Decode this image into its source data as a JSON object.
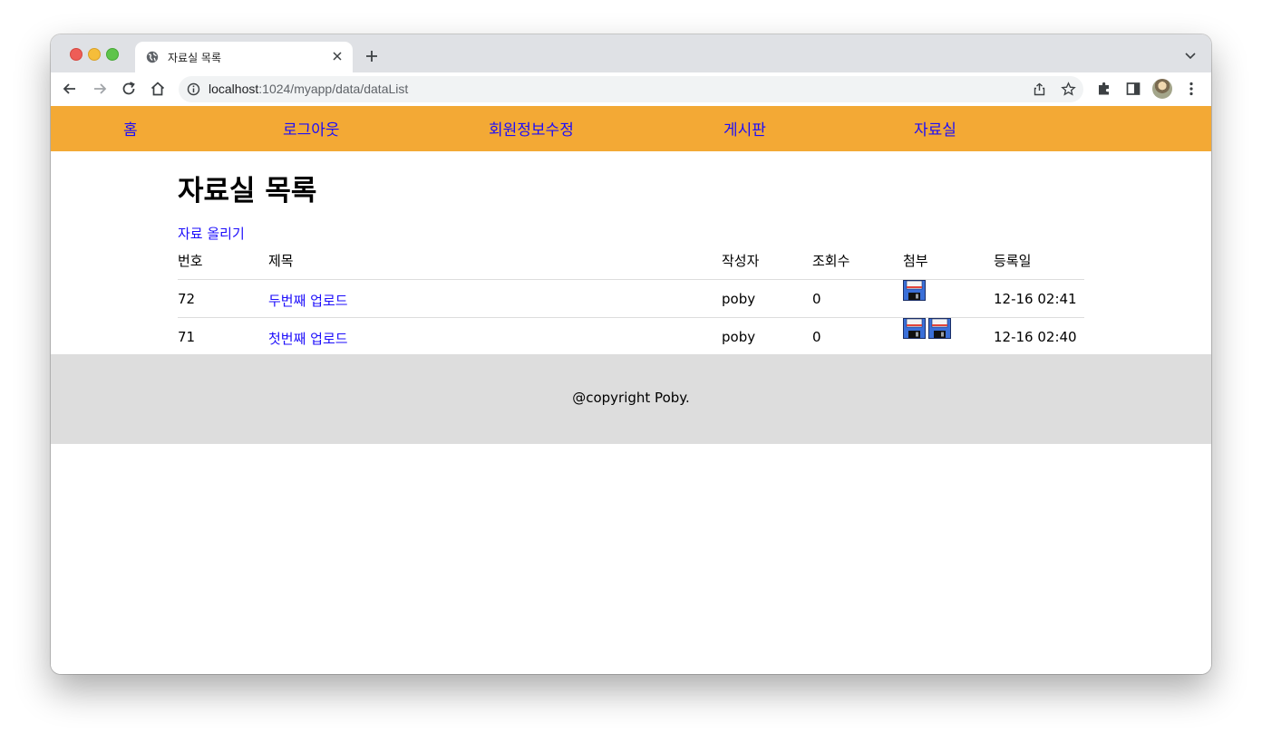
{
  "browser": {
    "tab_title": "자료실 목록",
    "url_host": "localhost",
    "url_rest": ":1024/myapp/data/dataList"
  },
  "nav": {
    "items": [
      "홈",
      "로그아웃",
      "회원정보수정",
      "게시판",
      "자료실"
    ]
  },
  "page": {
    "title": "자료실 목록",
    "upload_link": "자료 올리기"
  },
  "table": {
    "headers": [
      "번호",
      "제목",
      "작성자",
      "조회수",
      "첨부",
      "등록일"
    ],
    "rows": [
      {
        "no": "72",
        "title": "두번째 업로드",
        "writer": "poby",
        "views": "0",
        "attachments": 1,
        "date": "12-16 02:41"
      },
      {
        "no": "71",
        "title": "첫번째 업로드",
        "writer": "poby",
        "views": "0",
        "attachments": 2,
        "date": "12-16 02:40"
      }
    ]
  },
  "footer": {
    "text": "@copyright Poby."
  },
  "colors": {
    "nav_bg": "#f3a935",
    "link": "#1c0dfb",
    "footer_bg": "#dddddd"
  }
}
